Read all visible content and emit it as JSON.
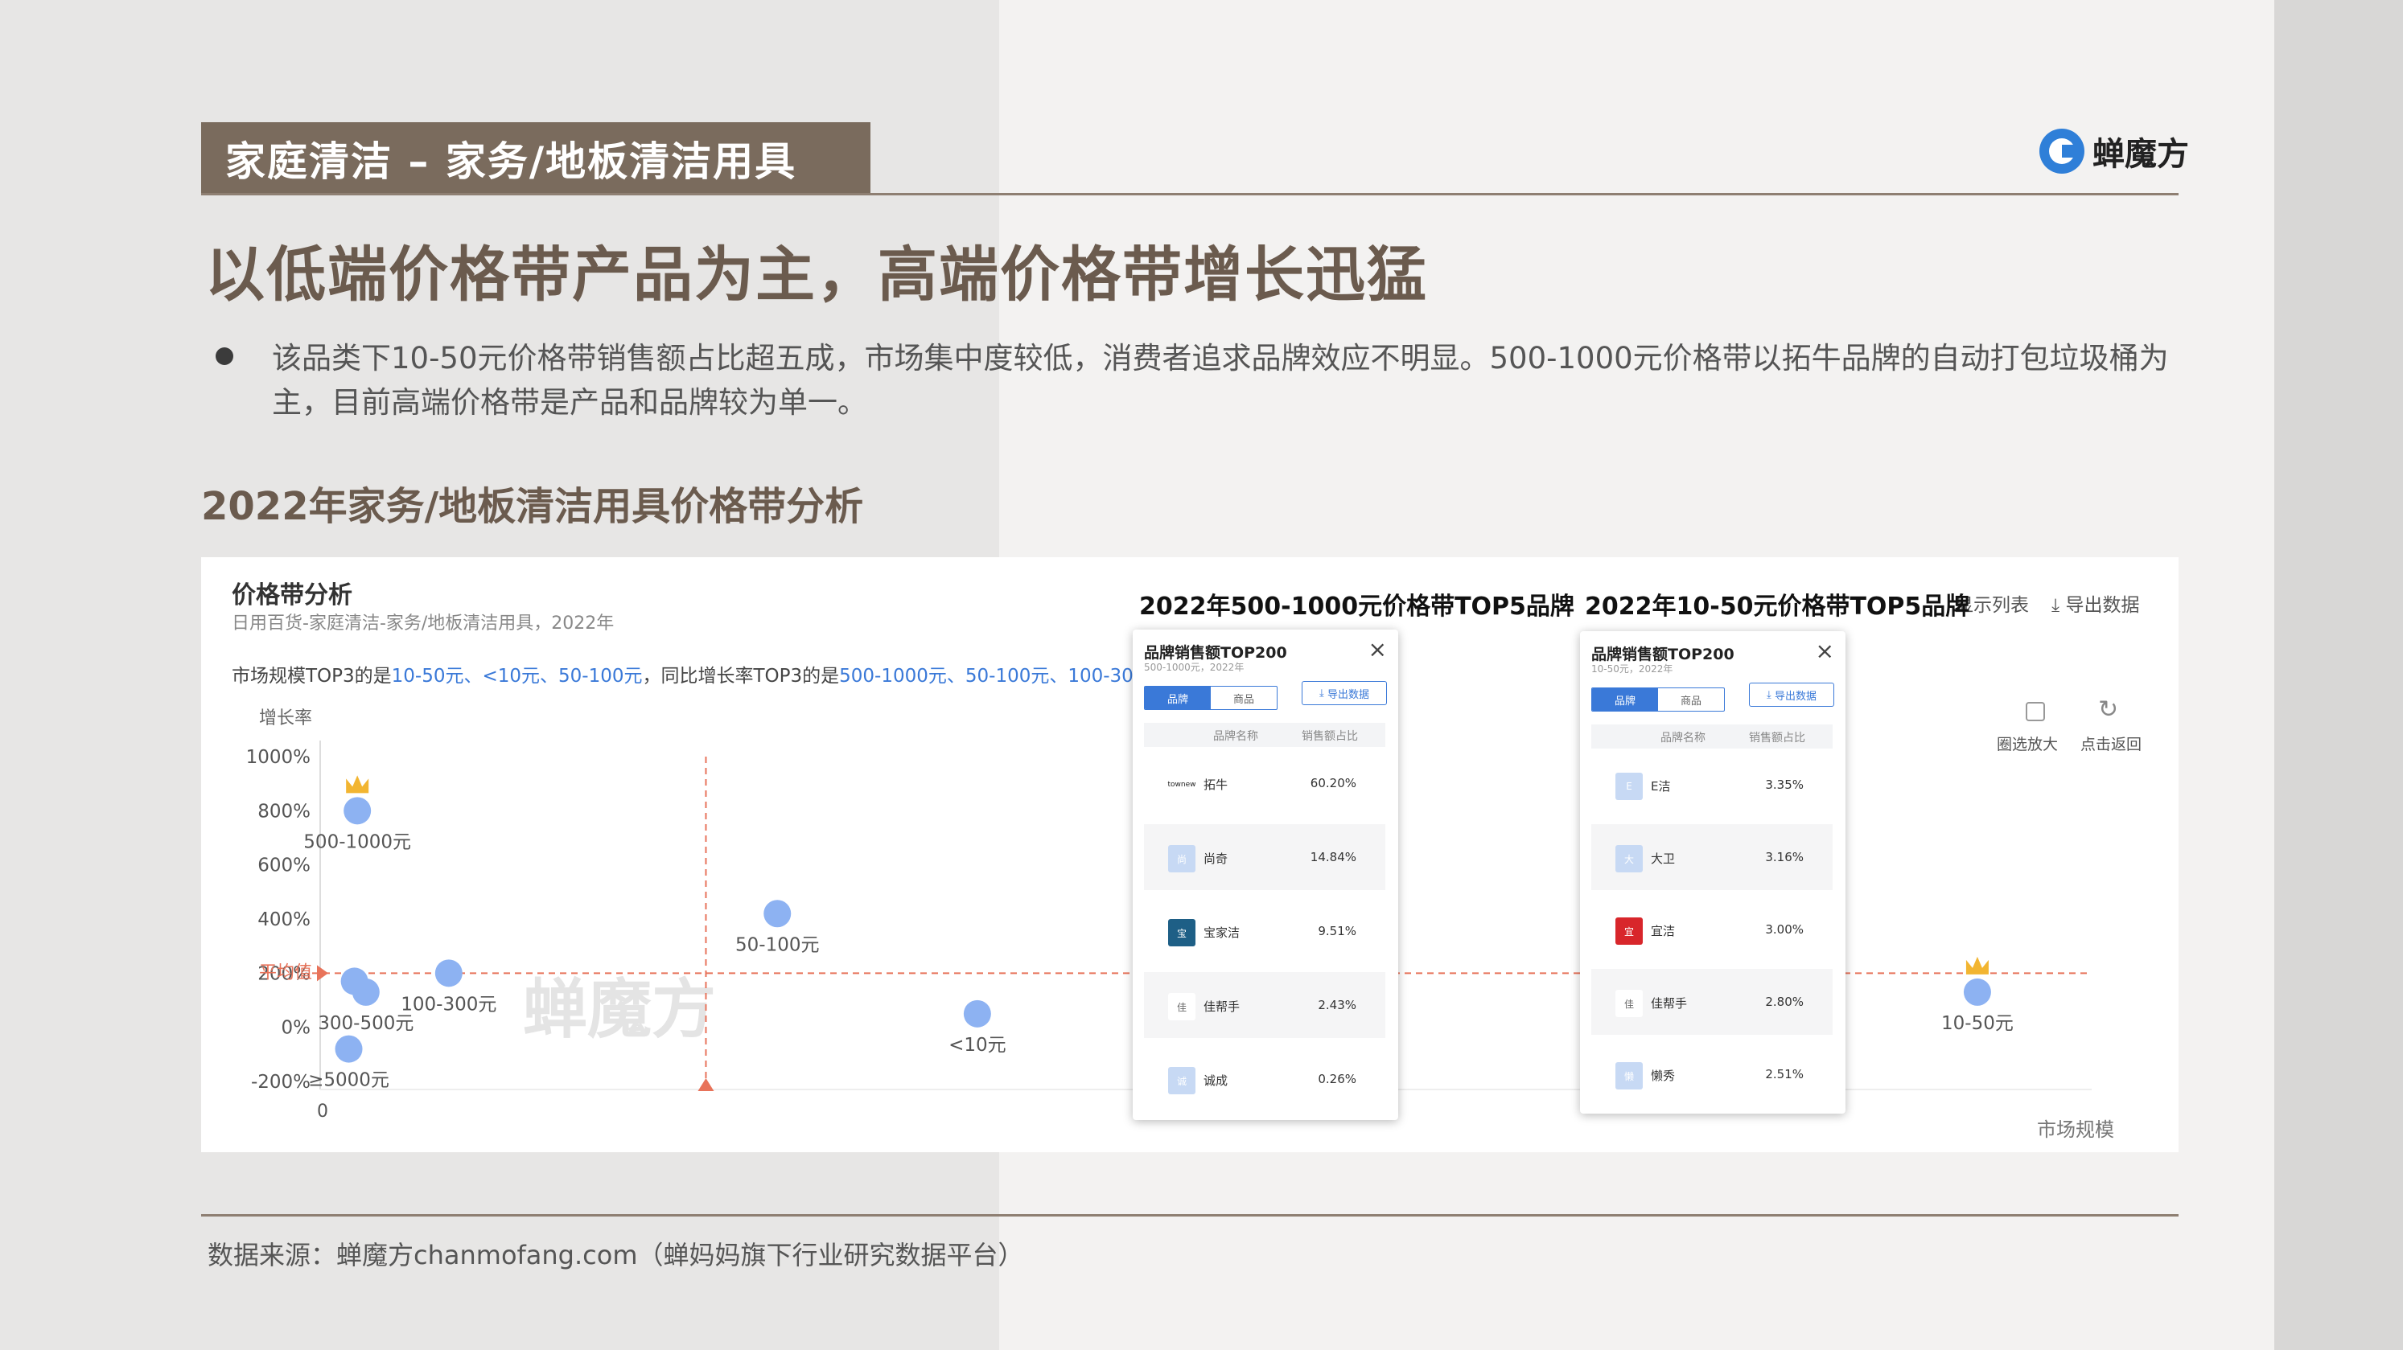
{
  "header": {
    "tag": "家庭清洁 – 家务/地板清洁用具",
    "logo_text": "蝉魔方"
  },
  "headline": "以低端价格带产品为主，高端价格带增长迅猛",
  "bullet": "该品类下10-50元价格带销售额占比超五成，市场集中度较低，消费者追求品牌效应不明显。500-1000元价格带以拓牛品牌的自动打包垃圾桶为主，目前高端价格带是产品和品牌较为单一。",
  "section_title": "2022年家务/地板清洁用具价格带分析",
  "panel": {
    "title": "价格带分析",
    "subtitle": "日用百货-家庭清洁-家务/地板清洁用具，2022年",
    "summary": {
      "prefix": "市场规模TOP3的是",
      "scale_top3": "10-50元、<10元、50-100元",
      "mid": "，同比增长率TOP3的是",
      "growth_top3": "500-1000元、50-100元、100-300元"
    },
    "controls": {
      "show_list": "显示列表",
      "export": "导出数据",
      "zoom": "圈选放大",
      "reset": "点击返回"
    },
    "watermark": "蝉魔方"
  },
  "chart_data": {
    "type": "scatter",
    "xlabel": "市场规模",
    "ylabel": "增长率",
    "yticks": [
      "1000%",
      "800%",
      "600%",
      "400%",
      "200%",
      "0%",
      "-200%"
    ],
    "ytick_values": [
      1000,
      800,
      600,
      400,
      200,
      0,
      -200
    ],
    "ylim": [
      -200,
      1000
    ],
    "x_origin_label": "0",
    "avg_label": "平均值",
    "avg_growth": 200,
    "points": [
      {
        "label": "500-1000元",
        "x": 0.3,
        "y": 800,
        "crown": true
      },
      {
        "label": "100-300元",
        "x": 3.5,
        "y": 200
      },
      {
        "label": "300-500元",
        "x": 0.6,
        "y": 130
      },
      {
        "label": "≥5000元",
        "x": 0.0,
        "y": -80
      },
      {
        "label": "",
        "x": 0.2,
        "y": 170
      },
      {
        "label": "50-100元",
        "x": 15,
        "y": 420
      },
      {
        "label": "<10元",
        "x": 22,
        "y": 50
      },
      {
        "label": "10-50元",
        "x": 57,
        "y": 130,
        "crown": true
      }
    ],
    "xlim": [
      -1,
      61
    ],
    "avg_scale_x": 12.5
  },
  "popups": [
    {
      "heading": "2022年500-1000元价格带TOP5品牌",
      "title": "品牌销售额TOP200",
      "subtitle": "500-1000元，2022年",
      "tabs": [
        "品牌",
        "商品"
      ],
      "export": "导出数据",
      "col_brand": "品牌名称",
      "col_share": "销售额占比",
      "rows": [
        {
          "logo": "townew",
          "brand": "拓牛",
          "share": "60.20%"
        },
        {
          "logo": "尚",
          "brand": "尚奇",
          "share": "14.84%"
        },
        {
          "logo": "宝",
          "brand": "宝家洁",
          "share": "9.51%"
        },
        {
          "logo": "佳",
          "brand": "佳帮手",
          "share": "2.43%"
        },
        {
          "logo": "诚",
          "brand": "诚成",
          "share": "0.26%"
        }
      ]
    },
    {
      "heading": "2022年10-50元价格带TOP5品牌",
      "title": "品牌销售额TOP200",
      "subtitle": "10-50元，2022年",
      "tabs": [
        "品牌",
        "商品"
      ],
      "export": "导出数据",
      "col_brand": "品牌名称",
      "col_share": "销售额占比",
      "rows": [
        {
          "logo": "E",
          "brand": "E洁",
          "share": "3.35%"
        },
        {
          "logo": "大",
          "brand": "大卫",
          "share": "3.16%"
        },
        {
          "logo": "宜",
          "brand": "宜洁",
          "share": "3.00%"
        },
        {
          "logo": "佳",
          "brand": "佳帮手",
          "share": "2.80%"
        },
        {
          "logo": "懒",
          "brand": "懒秀",
          "share": "2.51%"
        }
      ]
    }
  ],
  "footer": "数据来源：蝉魔方chanmofang.com（蝉妈妈旗下行业研究数据平台）",
  "colors": {
    "brand_brown": "#7a6b5d",
    "accent_blue": "#3a79d8",
    "point_blue": "#8db2f2",
    "avg_red": "#e8735a"
  }
}
